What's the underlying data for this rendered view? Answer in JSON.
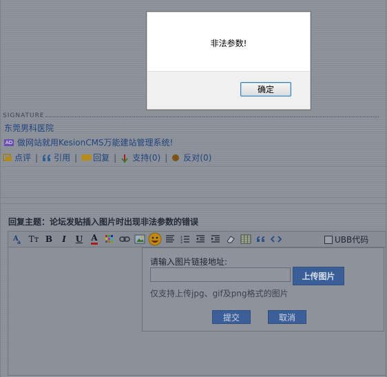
{
  "dialog": {
    "message": "非法参数!",
    "ok_label": "确定"
  },
  "signature": {
    "label": "SIGNATURE",
    "link": "东莞男科医院",
    "ad_badge": "AD",
    "ad_text": "做网站就用KesionCMS万能建站管理系统!"
  },
  "post_actions": {
    "comment": "点评",
    "quote": "引用",
    "reply": "回复",
    "support": "支持",
    "support_count": "(0)",
    "oppose": "反对",
    "oppose_count": "(0)",
    "separator": "|"
  },
  "reply": {
    "title": "回复主题：论坛发贴插入图片时出现非法参数的错误"
  },
  "toolbar": {
    "bold": "B",
    "italic": "I",
    "underline": "U",
    "font_color": "A",
    "font_size": "Tт",
    "ubb_label": "UBB代码"
  },
  "image_popup": {
    "url_label": "请输入图片链接地址:",
    "upload_label": "上传图片",
    "hint": "仅支持上传jpg、gif及png格式的图片",
    "submit_label": "提交",
    "cancel_label": "取消"
  },
  "colors": {
    "overlay": "#8d929b",
    "link": "#21457e",
    "button_blue": "#3a5f98",
    "ad_badge": "#6a4fb0"
  }
}
